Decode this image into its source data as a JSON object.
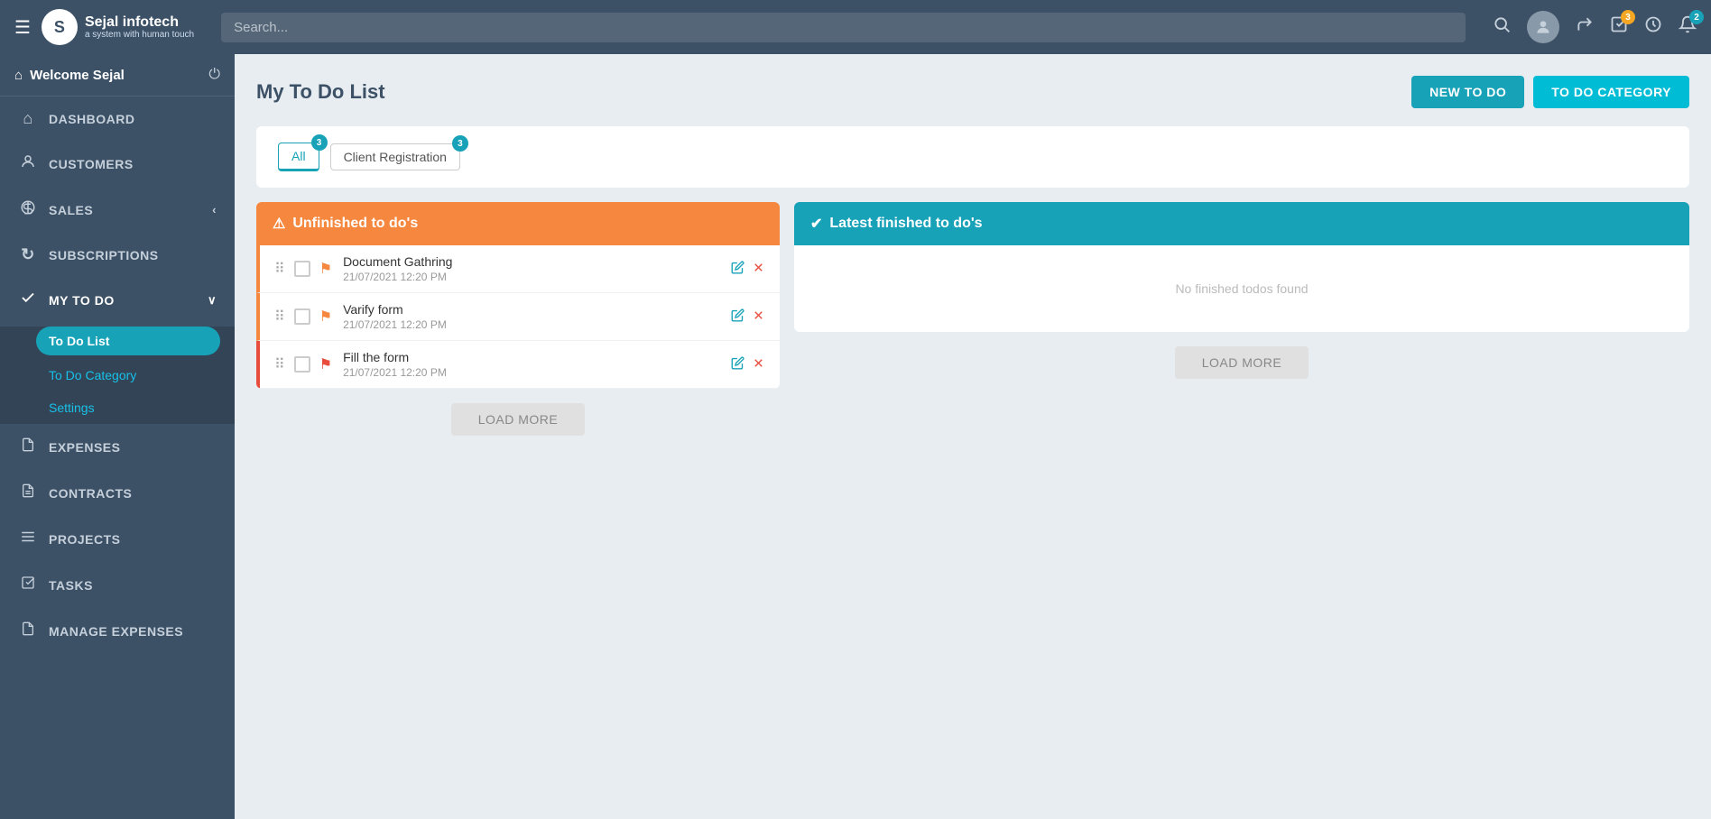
{
  "topnav": {
    "menu_icon": "☰",
    "logo_letter": "S",
    "logo_name": "Sejal infotech",
    "logo_tagline": "a system with human touch",
    "search_placeholder": "Search...",
    "icons": {
      "search": "🔍",
      "forward": "↪",
      "tasks_badge": "3",
      "clock": "⏱",
      "bell_badge": "2"
    }
  },
  "sidebar": {
    "welcome_text": "Welcome Sejal",
    "nav_items": [
      {
        "id": "dashboard",
        "label": "DASHBOARD",
        "icon": "⌂",
        "has_sub": false
      },
      {
        "id": "customers",
        "label": "CUSTOMERS",
        "icon": "👤",
        "has_sub": false
      },
      {
        "id": "sales",
        "label": "SALES",
        "icon": "⚖",
        "has_sub": true,
        "chevron": "‹"
      },
      {
        "id": "subscriptions",
        "label": "SUBSCRIPTIONS",
        "icon": "↻",
        "has_sub": false
      },
      {
        "id": "my-todo",
        "label": "MY TO DO",
        "icon": "✓",
        "has_sub": true,
        "chevron": "∨",
        "active": true
      }
    ],
    "submenu": [
      {
        "id": "todo-list",
        "label": "To Do List",
        "active": true
      },
      {
        "id": "todo-category",
        "label": "To Do Category",
        "active": false
      },
      {
        "id": "settings",
        "label": "Settings",
        "active": false
      }
    ],
    "bottom_items": [
      {
        "id": "expenses",
        "label": "EXPENSES",
        "icon": "📄"
      },
      {
        "id": "contracts",
        "label": "CONTRACTS",
        "icon": "📝"
      },
      {
        "id": "projects",
        "label": "PROJECTS",
        "icon": "☰"
      },
      {
        "id": "tasks",
        "label": "TASKS",
        "icon": "📋"
      },
      {
        "id": "manage-expenses",
        "label": "MANAGE EXPENSES",
        "icon": "📄"
      }
    ]
  },
  "page": {
    "title": "My To Do List",
    "btn_new_todo": "NEW TO DO",
    "btn_todo_category": "TO DO CATEGORY"
  },
  "filter_tabs": [
    {
      "id": "all",
      "label": "All",
      "badge": "3",
      "active": true
    },
    {
      "id": "client-reg",
      "label": "Client Registration",
      "badge": "3",
      "active": false
    }
  ],
  "unfinished": {
    "header": "Unfinished to do's",
    "items": [
      {
        "id": 1,
        "name": "Document Gathring",
        "time": "21/07/2021 12:20 PM",
        "flag_color": "orange"
      },
      {
        "id": 2,
        "name": "Varify form",
        "time": "21/07/2021 12:20 PM",
        "flag_color": "orange"
      },
      {
        "id": 3,
        "name": "Fill the form",
        "time": "21/07/2021 12:20 PM",
        "flag_color": "red"
      }
    ],
    "load_more": "LOAD MORE"
  },
  "finished": {
    "header": "Latest finished to do's",
    "empty_text": "No finished todos found",
    "load_more": "LOAD MORE"
  }
}
